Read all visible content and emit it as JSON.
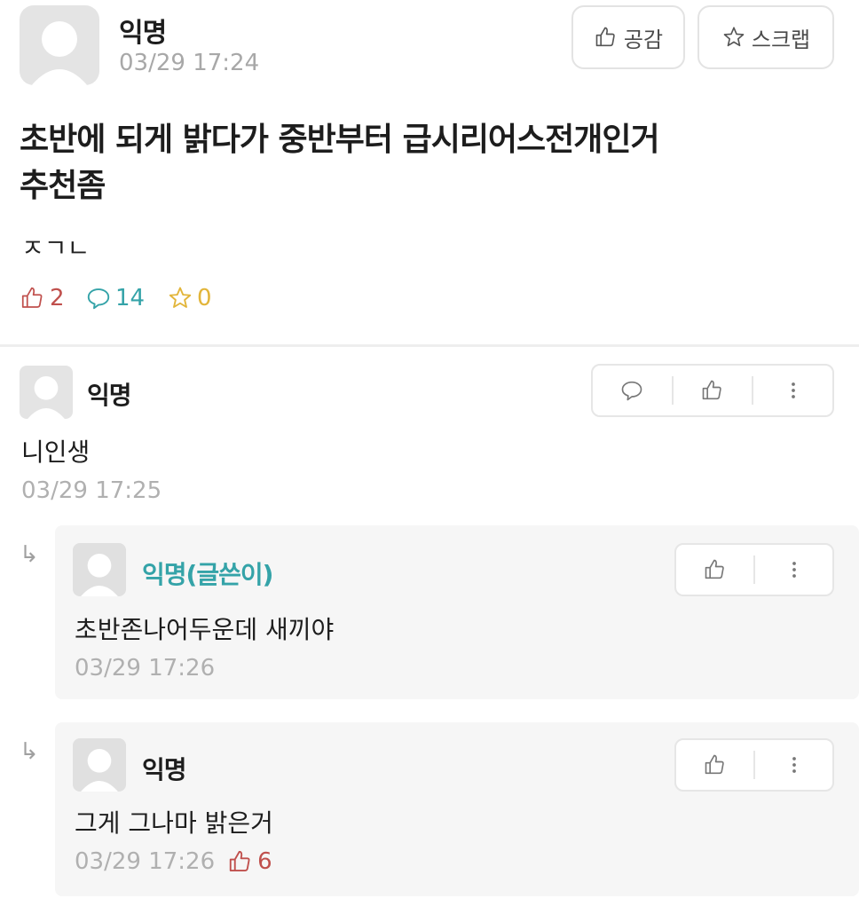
{
  "post": {
    "author": "익명",
    "time": "03/29 17:24",
    "like_button": "공감",
    "scrap_button": "스크랩",
    "title_line1": "초반에 되게 밝다가 중반부터 급시리어스전개인거",
    "title_line2": "추천좀",
    "body": "ㅈㄱㄴ",
    "stats": {
      "likes": "2",
      "comments": "14",
      "scraps": "0"
    }
  },
  "comments": [
    {
      "author": "익명",
      "text": "니인생",
      "time": "03/29 17:25"
    }
  ],
  "replies": [
    {
      "author": "익명(글쓴이)",
      "text": "초반존나어두운데 새끼야",
      "time": "03/29 17:26"
    },
    {
      "author": "익명",
      "text": "그게 그나마 밝은거",
      "time": "03/29 17:26",
      "likes": "6"
    }
  ],
  "reply_arrow": "↳",
  "colors": {
    "like": "#c0504d",
    "comment": "#34a3a8",
    "scrap": "#e2b53a",
    "op_author": "#34a3a8"
  },
  "icons": {
    "avatar": "default-avatar-icon",
    "like": "thumbs-up-icon",
    "comment": "speech-bubble-icon",
    "scrap": "star-icon",
    "more": "more-vertical-icon"
  }
}
